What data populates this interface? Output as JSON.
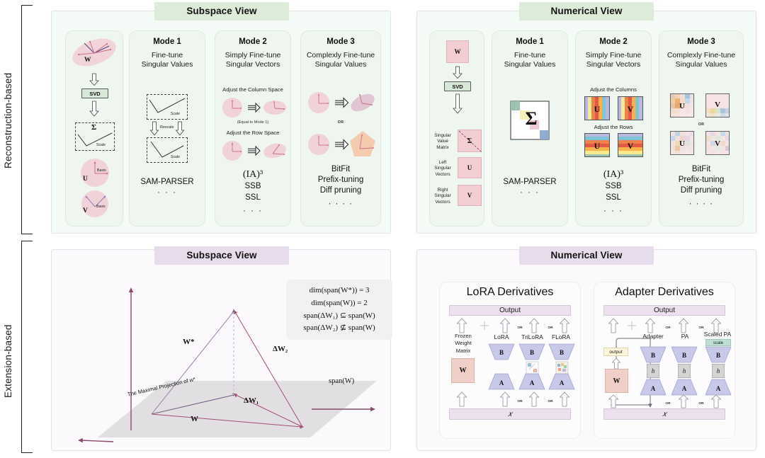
{
  "figure": {
    "categories": [
      {
        "id": "reconstruction",
        "label": "Reconstruction-based"
      },
      {
        "id": "extension",
        "label": "Extension-based"
      }
    ],
    "banners": {
      "top_left": "Subspace View",
      "top_right": "Numerical View",
      "bottom_left": "Subspace View",
      "bottom_right": "Numerical View"
    },
    "colors": {
      "green_banner": "#dcecd9",
      "violet_banner": "#e7dceb",
      "green_panel": "#f4faf6",
      "violet_panel": "#fbf9fc",
      "card_green": "#eef6ef",
      "pink_matrix": "#f2cdd2",
      "plum_arrow": "#9c4f6e",
      "lora_block": "#c8c9e8",
      "w_block": "#f0cfc8"
    }
  },
  "subspace_view": {
    "svd_flow": {
      "w_label": "W",
      "svd_label": "SVD",
      "sigma_label": "Σ",
      "sigma_scale_label": "Scale",
      "u_label": "U",
      "u_basis_label": "Basis",
      "v_label": "V",
      "v_basis_label": "Basis"
    },
    "modes": [
      {
        "title": "Mode 1",
        "subtitle": "Fine-tune\nSingular Values",
        "subtitle_line1": "Fine-tune",
        "subtitle_line2": "Singular Values",
        "diagram": {
          "top_box_caption": "Scale",
          "arrow_caption": "Rescale",
          "bottom_box_caption": "Scale"
        },
        "methods": [
          "SAM-PARSER",
          "· · ·"
        ]
      },
      {
        "title": "Mode 2",
        "subtitle_line1": "Simply Fine-tune",
        "subtitle_line2": "Singular Vectors",
        "diagram": {
          "caption_1": "Adjust the Column Space",
          "note_1": "(Equal to Mode 1)",
          "caption_2": "Adjust the Row Space"
        },
        "methods": [
          "(IA)³",
          "SSB",
          "SSL",
          "· · ·"
        ]
      },
      {
        "title": "Mode 3",
        "subtitle_line1": "Complexly Fine-tune",
        "subtitle_line2": "Singular Values",
        "diagram": {
          "or_label": "OR"
        },
        "methods": [
          "BitFit",
          "Prefix-tuning",
          "Diff pruning",
          "· · · ·"
        ]
      }
    ]
  },
  "numerical_view": {
    "svd_flow": {
      "w_label": "W",
      "svd_label": "SVD",
      "sigma_label": "Σ",
      "sigma_caption": "Singular\nValue\nMatrix",
      "sigma_caption_lines": [
        "Singular",
        "Value",
        "Matrix"
      ],
      "u_label": "U",
      "u_caption_lines": [
        "Left",
        "Singular",
        "Vectors"
      ],
      "v_label": "V",
      "v_caption_lines": [
        "Right",
        "Singular",
        "Vectors"
      ]
    },
    "modes": [
      {
        "title": "Mode 1",
        "subtitle_line1": "Fine-tune",
        "subtitle_line2": "Singular Values",
        "diagram": {
          "sigma_label": "Σ"
        },
        "methods": [
          "SAM-PARSER",
          "· · ·"
        ]
      },
      {
        "title": "Mode 2",
        "subtitle_line1": "Simply Fine-tune",
        "subtitle_line2": "Singular Vectors",
        "diagram": {
          "caption_1": "Adjust the Columns",
          "caption_2": "Adjust the Rows",
          "u_label": "U",
          "v_label": "V"
        },
        "methods": [
          "(IA)³",
          "SSB",
          "SSL",
          "· · ·"
        ]
      },
      {
        "title": "Mode 3",
        "subtitle_line1": "Complexly Fine-tune",
        "subtitle_line2": "Singular Values",
        "diagram": {
          "or_label": "OR",
          "u_label": "U",
          "v_label": "V"
        },
        "methods": [
          "BitFit",
          "Prefix-tuning",
          "Diff pruning",
          "· · · ·"
        ]
      }
    ]
  },
  "extension_subspace_plot": {
    "equations": [
      "dim(span(W*)) = 3",
      "dim(span(W)) = 2",
      "span(ΔW₁) ⊆ span(W)",
      "span(ΔW₂) ⊈ span(W)"
    ],
    "labels": {
      "w_star": "W*",
      "delta_w1": "ΔW₁",
      "delta_w2": "ΔW₂",
      "w": "W",
      "span_w": "span(W)",
      "projection": "The Maximal Projection of w*"
    }
  },
  "extension_numerical": {
    "lora": {
      "panel_title": "LoRA Derivatives",
      "output_label": "Output",
      "input_label": "𝑥",
      "plus_symbol": "+",
      "or_label": "OR",
      "frozen_caption_lines": [
        "Frozen",
        "Weight",
        "Matrix"
      ],
      "w_label": "W",
      "columns": [
        {
          "name": "LoRA",
          "blocks": [
            "B",
            "A"
          ]
        },
        {
          "name": "TriLoRA",
          "blocks": [
            "B",
            "A"
          ],
          "has_middle": true
        },
        {
          "name": "FLoRA",
          "blocks": [
            "B",
            "A"
          ],
          "has_middle": true
        }
      ]
    },
    "adapter": {
      "panel_title": "Adapter Derivatives",
      "output_label": "Output",
      "input_label": "𝑥",
      "plus_symbol": "+",
      "or_label": "OR",
      "w_label": "W",
      "output_chip_label": "output",
      "scale_chip_label": "scale",
      "columns": [
        {
          "name": "Adapter",
          "blocks": [
            "B",
            "h",
            "A"
          ]
        },
        {
          "name": "PA",
          "blocks": [
            "B",
            "h",
            "A"
          ]
        },
        {
          "name": "Scaled PA",
          "blocks": [
            "B",
            "h",
            "A"
          ],
          "has_scale": true
        }
      ]
    }
  }
}
